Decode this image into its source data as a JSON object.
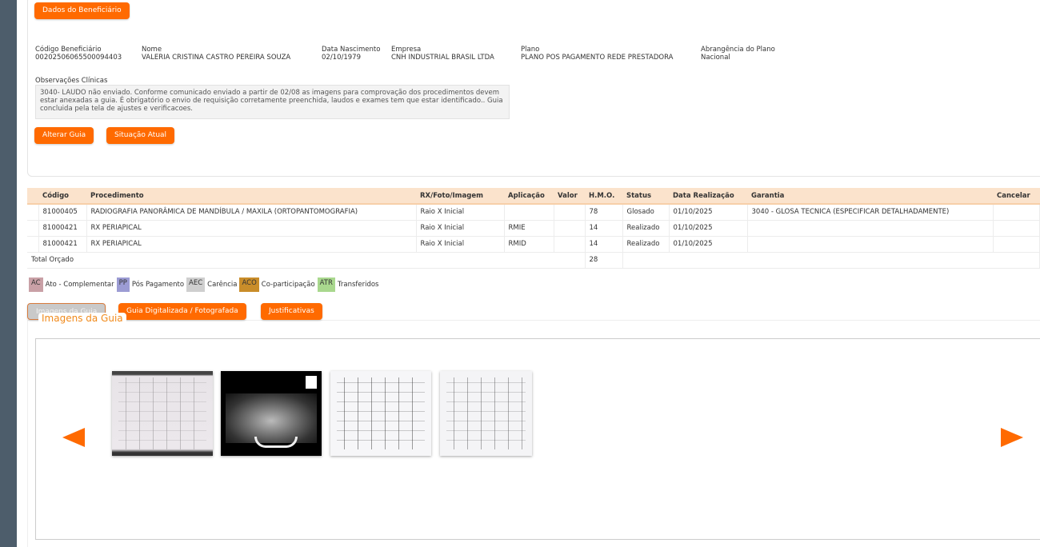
{
  "header": {
    "dados_button": "Dados do Beneficiário"
  },
  "beneficiary": {
    "codigo": {
      "label": "Código Beneficiário",
      "value": "00202506065500094403"
    },
    "nome": {
      "label": "Nome",
      "value": "VALERIA CRISTINA CASTRO PEREIRA SOUZA"
    },
    "nascimento": {
      "label": "Data Nascimento",
      "value": "02/10/1979"
    },
    "empresa": {
      "label": "Empresa",
      "value": "CNH INDUSTRIAL BRASIL LTDA"
    },
    "plano": {
      "label": "Plano",
      "value": "PLANO POS PAGAMENTO REDE PRESTADORA"
    },
    "abrangencia": {
      "label": "Abrangência do Plano",
      "value": "Nacional"
    }
  },
  "observacoes": {
    "label": "Observações Clínicas",
    "text": "3040- LAUDO não enviado. Conforme comunicado enviado a partir de 02/08 as imagens para comprovação dos procedimentos devem estar anexadas a guia. É obrigatório o envio de requisição corretamente preenchida, laudos e exames tem que estar identificado.. Guia concluida pela tela de ajustes e verificacoes."
  },
  "actions": {
    "alterar": "Alterar Guia",
    "situacao": "Situação Atual"
  },
  "table": {
    "headers": [
      "Código",
      "Procedimento",
      "RX/Foto/Imagem",
      "Aplicação",
      "Valor",
      "H.M.O.",
      "Status",
      "Data Realização",
      "Garantia",
      "Cancelar"
    ],
    "rows": [
      {
        "codigo": "81000405",
        "procedimento": "RADIOGRAFIA PANORÂMICA DE MANDÍBULA / MAXILA (ORTOPANTOMOGRAFIA)",
        "rx": "Raio X Inicial",
        "aplicacao": "",
        "valor": "",
        "hmo": "78",
        "status": "Glosado",
        "data": "01/10/2025",
        "garantia": "3040 - GLOSA TECNICA (ESPECIFICAR DETALHADAMENTE)"
      },
      {
        "codigo": "81000421",
        "procedimento": "RX PERIAPICAL",
        "rx": "Raio X Inicial",
        "aplicacao": "RMIE",
        "valor": "",
        "hmo": "14",
        "status": "Realizado",
        "data": "01/10/2025",
        "garantia": ""
      },
      {
        "codigo": "81000421",
        "procedimento": "RX PERIAPICAL",
        "rx": "Raio X Inicial",
        "aplicacao": "RMID",
        "valor": "",
        "hmo": "14",
        "status": "Realizado",
        "data": "01/10/2025",
        "garantia": ""
      }
    ],
    "total": {
      "label": "Total Orçado",
      "hmo": "28"
    }
  },
  "legend": [
    {
      "code": "AC",
      "label": "Ato - Complementar",
      "color": "#c9a0a6"
    },
    {
      "code": "PP",
      "label": "Pós Pagamento",
      "color": "#9c9cd4"
    },
    {
      "code": "AEC",
      "label": "Carência",
      "color": "#cfcfcf"
    },
    {
      "code": "ACO",
      "label": "Co-participação",
      "color": "#c98d2a"
    },
    {
      "code": "ATR",
      "label": "Transferidos",
      "color": "#a9d88e"
    }
  ],
  "tabs": {
    "imagens": "Imagens da Guia",
    "digitalizada": "Guia Digitalizada / Fotografada",
    "justificativas": "Justificativas"
  },
  "gallery": {
    "title": "Imagens da Guia",
    "icons": {
      "prev": "arrow-left-icon",
      "next": "arrow-right-icon"
    }
  },
  "colors": {
    "accent": "#ff6a00",
    "sidebar": "#4d5d6b",
    "table_header": "#fbe3cc"
  }
}
